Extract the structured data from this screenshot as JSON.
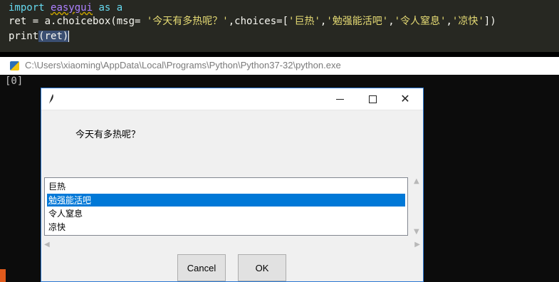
{
  "editor": {
    "line1": {
      "kw_import": "import",
      "module": "easygui",
      "kw_as": "as",
      "alias": "a"
    },
    "line2": {
      "prefix": "ret = a.choicebox(msg= ",
      "msg_str": "'今天有多热呢？'",
      "mid": ",choices=[",
      "c1": "'巨热'",
      "c2": "'勉强能活吧'",
      "c3": "'令人窒息'",
      "c4": "'凉快'",
      "comma": ",",
      "suffix": "])"
    },
    "line3": {
      "fn": "print",
      "arg": "(ret)"
    }
  },
  "console": {
    "title": "C:\\Users\\xiaoming\\AppData\\Local\\Programs\\Python\\Python37-32\\python.exe",
    "output": "[0]"
  },
  "dialog": {
    "message": "今天有多热呢？",
    "choices": [
      "巨热",
      "勉强能活吧",
      "令人窒息",
      "凉快"
    ],
    "selected_index": 1,
    "cancel_label": "Cancel",
    "ok_label": "OK",
    "close_glyph": "✕"
  },
  "colors": {
    "selection": "#0078d7",
    "dialog_border": "#2b78d2",
    "editor_bg": "#272822"
  }
}
